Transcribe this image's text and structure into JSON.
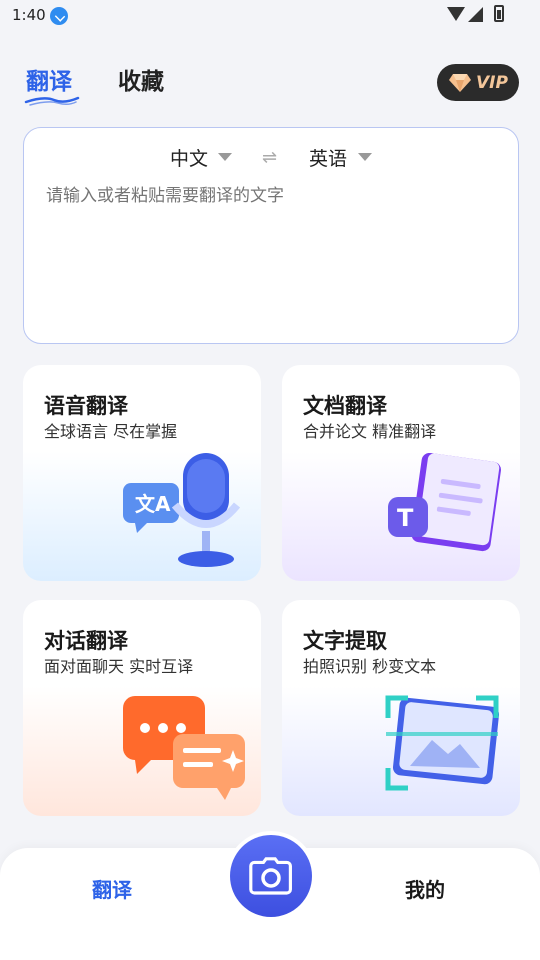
{
  "status_bar": {
    "time": "1:40"
  },
  "header": {
    "tabs": [
      {
        "label": "翻译",
        "active": true
      },
      {
        "label": "收藏",
        "active": false
      }
    ],
    "vip_label": "VIP"
  },
  "translator": {
    "source_lang": "中文",
    "target_lang": "英语",
    "swap_glyph": "⇌",
    "placeholder": "请输入或者粘贴需要翻译的文字",
    "value": ""
  },
  "features": [
    {
      "title": "语音翻译",
      "subtitle": "全球语言 尽在掌握",
      "icon": "microphone-icon"
    },
    {
      "title": "文档翻译",
      "subtitle": "合并论文 精准翻译",
      "icon": "document-icon"
    },
    {
      "title": "对话翻译",
      "subtitle": "面对面聊天 实时互译",
      "icon": "chat-bubbles-icon"
    },
    {
      "title": "文字提取",
      "subtitle": "拍照识别 秒变文本",
      "icon": "scan-image-icon"
    }
  ],
  "bottom_nav": {
    "left_label": "翻译",
    "right_label": "我的",
    "center_icon": "camera-icon"
  },
  "colors": {
    "accent": "#2e63e8",
    "background": "#f3f4f8",
    "vip_bg": "#2b2b2b",
    "vip_text": "#f3c69a"
  }
}
